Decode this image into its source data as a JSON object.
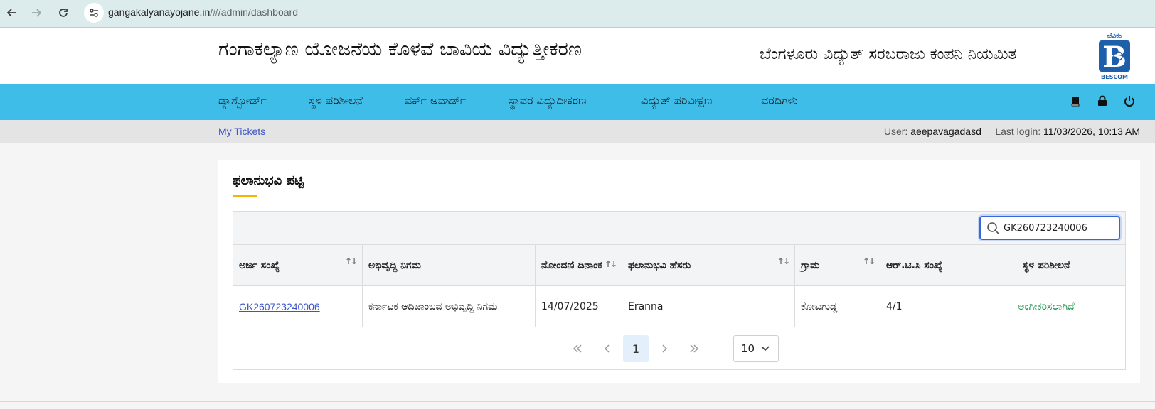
{
  "browser": {
    "url_host": "gangakalyanayojane.in",
    "url_path": "/#/admin/dashboard"
  },
  "header": {
    "site_title": "ಗಂಗಾಕಲ್ಯಾಣ ಯೋಜನೆಯ ಕೊಳವೆ ಬಾವಿಯ ವಿದ್ಯುತ್ತೀಕರಣ",
    "company_name": "ಬೆಂಗಳೂರು ವಿದ್ಯುತ್ ಸರಬರಾಜು ಕಂಪನಿ ನಿಯಮಿತ",
    "logo_top_text": "ಬೆವಿಕಂ",
    "logo_bottom_text": "BESCOM"
  },
  "nav": {
    "items": [
      {
        "label": "ಡ್ಯಾಶ್ಬೋರ್ಡ್"
      },
      {
        "label": "ಸ್ಥಳ ಪರಿಶೀಲನೆ"
      },
      {
        "label": "ವರ್ಕ್ ಅವಾರ್ಡ್"
      },
      {
        "label": "ಸ್ಥಾವರ ವಿದ್ಯುದೀಕರಣ"
      },
      {
        "label": "ವಿದ್ಯುತ್ ಪರಿವೀಕ್ಷಣ"
      },
      {
        "label": "ವರದಿಗಳು"
      }
    ],
    "icons": [
      "book-icon",
      "lock-icon",
      "power-icon"
    ]
  },
  "subbar": {
    "my_tickets": "My Tickets",
    "user_label": "User:",
    "user_value": "aeepavagadasd",
    "last_login_label": "Last login:",
    "last_login_value": "11/03/2026, 10:13 AM"
  },
  "card": {
    "title": "ಫಲಾನುಭವಿ ಪಟ್ಟಿ",
    "search_value": "GK260723240006",
    "columns": [
      "ಅರ್ಜಿ ಸಂಖ್ಯೆ",
      "ಅಭಿವೃದ್ಧಿ ನಿಗಮ",
      "ನೋಂದಣಿ ದಿನಾಂಕ",
      "ಫಲಾನುಭವಿ ಹೆಸರು",
      "ಗ್ರಾಮ",
      "ಆರ್.ಟಿ.ಸಿ ಸಂಖ್ಯೆ",
      "ಸ್ಥಳ ಪರಿಶೀಲನೆ"
    ],
    "rows": [
      {
        "application_no": "GK260723240006",
        "corporation": "ಕರ್ನಾಟಕ ಆದಿಜಾಂಬವ ಅಭಿವೃದ್ಧಿ ನಿಗಮ",
        "registration_date": "14/07/2025",
        "beneficiary_name": "Eranna",
        "village": "ಕೋಟಗುಡ್ಡ",
        "rtc_no": "4/1",
        "site_inspection": "ಅಂಗೀಕರಿಸಲಾಗಿದೆ"
      }
    ],
    "pagination": {
      "current_page": "1",
      "page_size": "10"
    }
  },
  "colors": {
    "navbar": "#3fbde9",
    "link": "#3b55c9",
    "status_green": "#1a8f4b",
    "title_accent": "#f5b400"
  }
}
